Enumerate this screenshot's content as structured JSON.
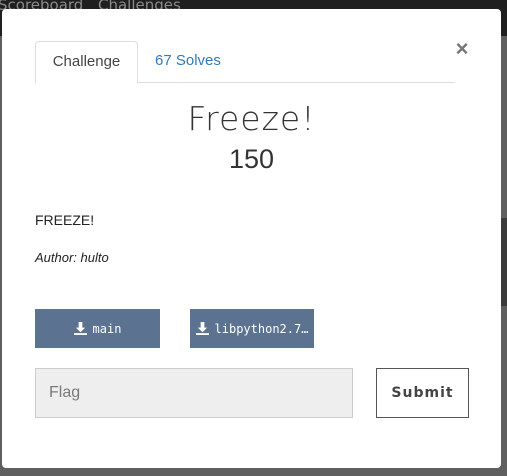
{
  "background": {
    "nav_items": [
      "Scoreboard",
      "Challenges"
    ]
  },
  "modal": {
    "tabs": [
      {
        "label": "Challenge",
        "active": true
      },
      {
        "label": "67 Solves",
        "active": false
      }
    ],
    "close_label": "×",
    "challenge": {
      "name": "Freeze!",
      "points": "150",
      "description": "FREEZE!",
      "author": "Author: hulto"
    },
    "files": [
      {
        "label": "main",
        "icon": "download-icon"
      },
      {
        "label": "libpython2.7…",
        "icon": "download-icon"
      }
    ],
    "flag": {
      "value": "",
      "placeholder": "Flag"
    },
    "submit_label": "Submit"
  },
  "colors": {
    "accent": "#337ab7",
    "file_button": "#5b7290"
  }
}
